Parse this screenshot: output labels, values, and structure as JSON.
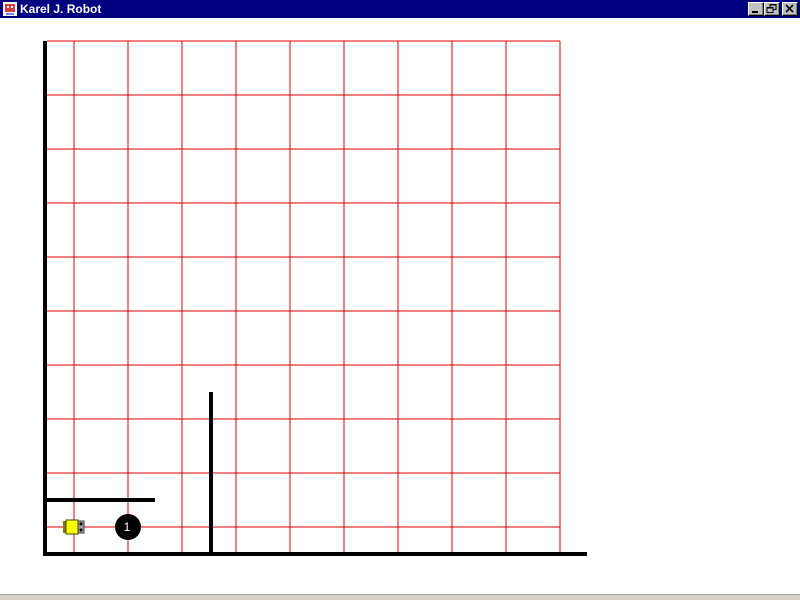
{
  "window": {
    "title": "Karel J. Robot",
    "icon": "karel-app-icon",
    "controls": [
      "minimize-icon",
      "restore-icon",
      "close-icon"
    ]
  },
  "world": {
    "streets": 9,
    "avenues": 10,
    "grid_color": "#e00000",
    "wall_color": "#000000",
    "walls": [
      {
        "type": "horizontal",
        "above_street": 1,
        "from_avenue": 1,
        "to_avenue": 2
      },
      {
        "type": "vertical",
        "east_of_avenue": 3,
        "from_street": 1,
        "to_street": 3
      }
    ],
    "robot": {
      "street": 1,
      "avenue": 1,
      "direction": "east",
      "color": "#ffff00"
    },
    "beepers": [
      {
        "street": 1,
        "avenue": 2,
        "count": "1"
      }
    ]
  }
}
